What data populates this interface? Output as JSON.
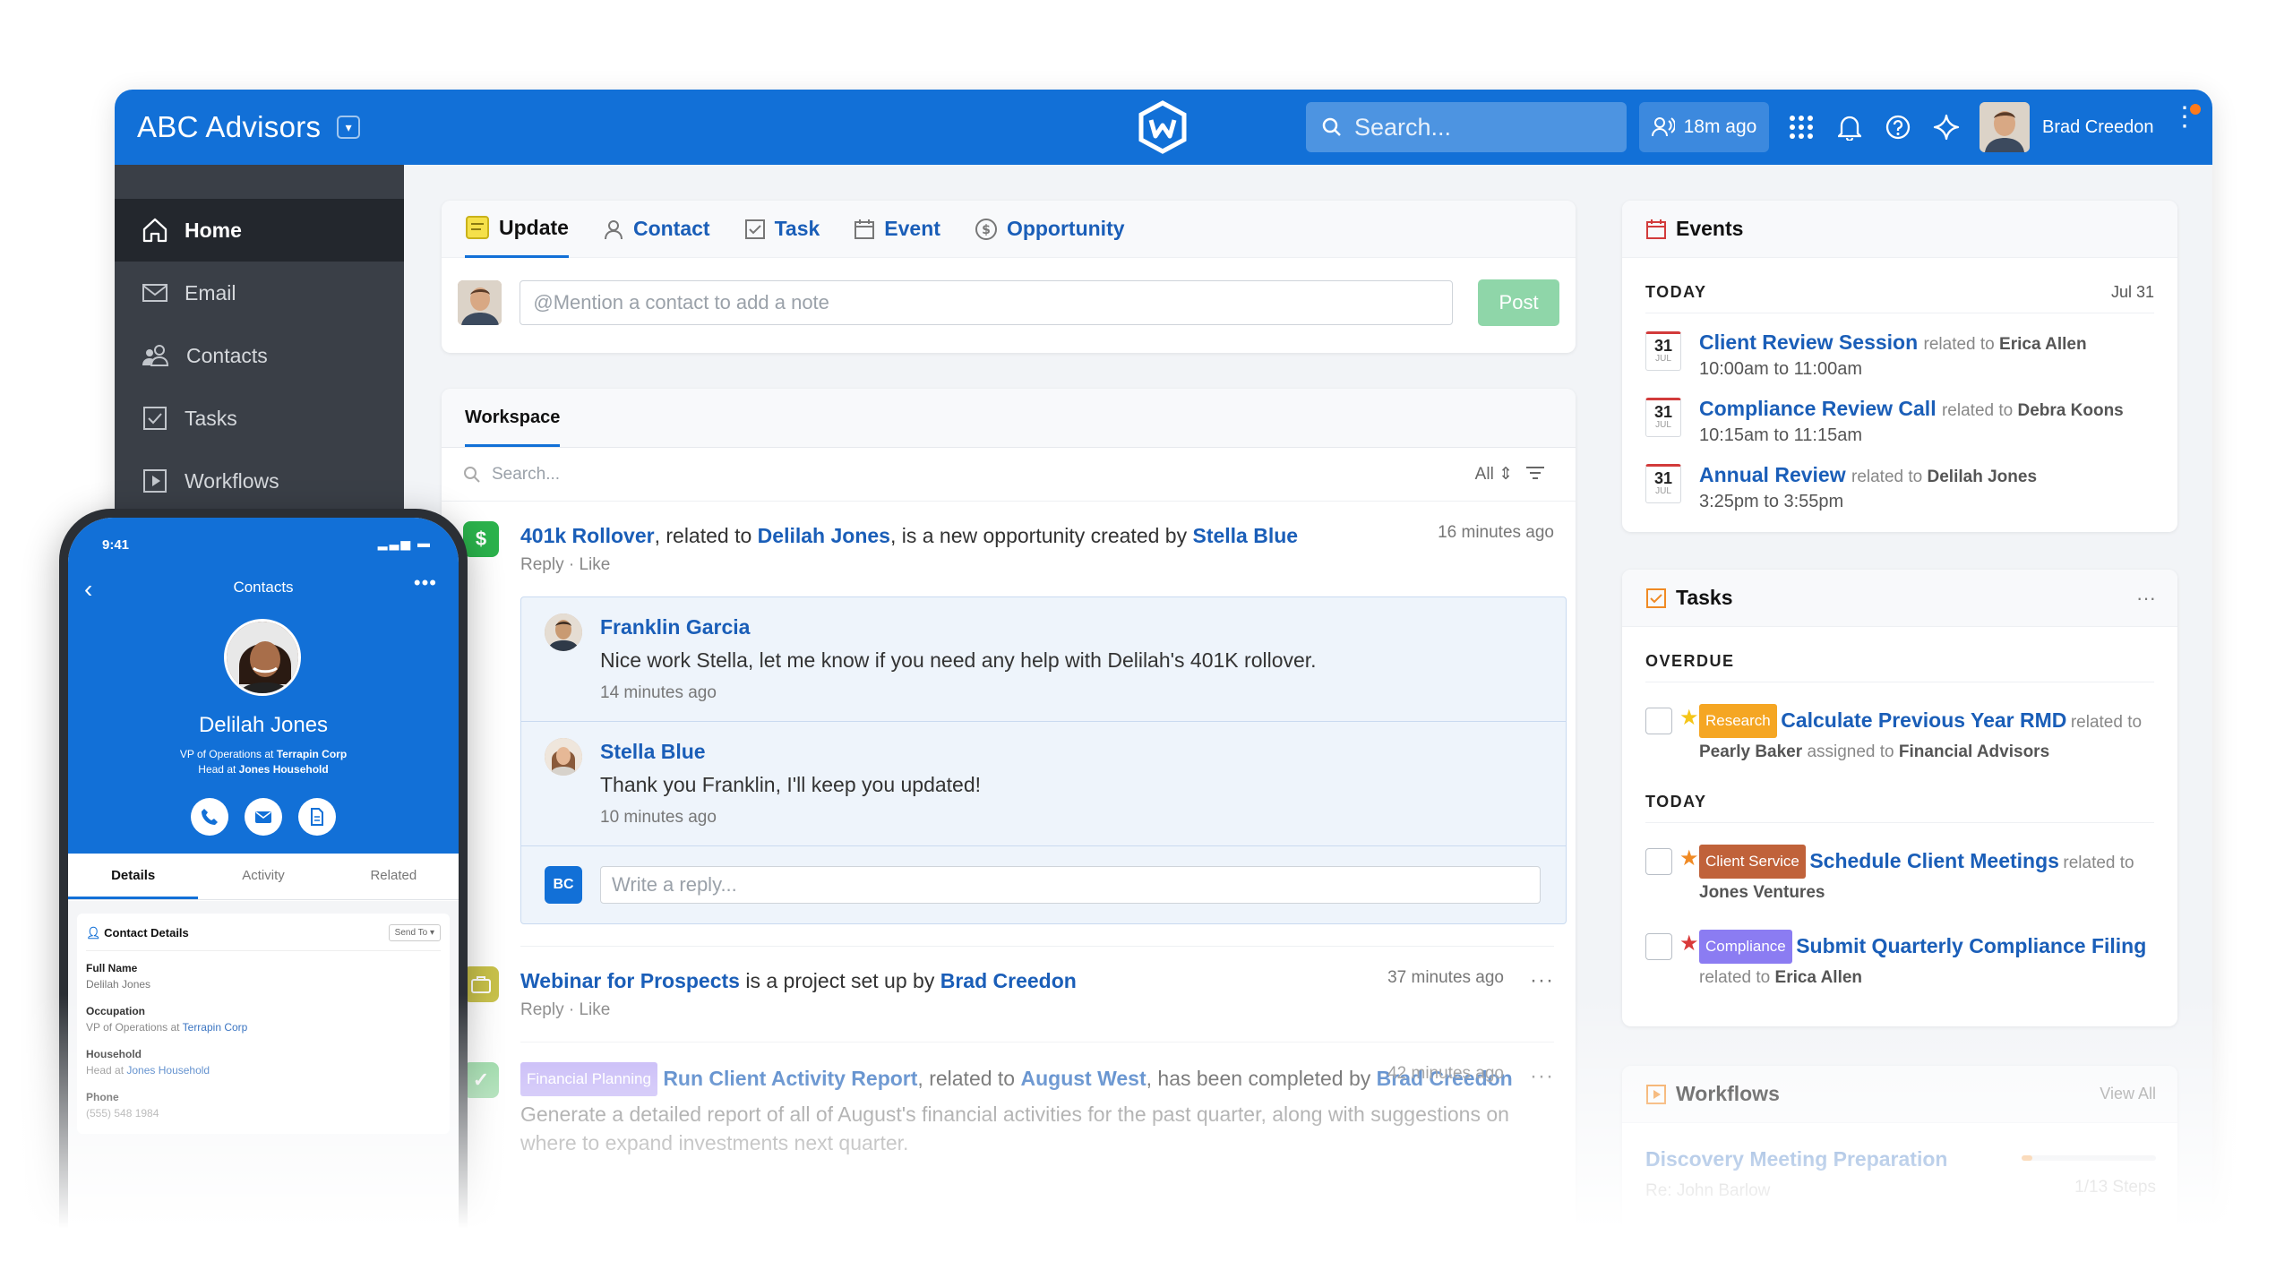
{
  "header": {
    "org_name": "ABC Advisors",
    "search_placeholder": "Search...",
    "sync_text": "18m ago",
    "user_name": "Brad Creedon"
  },
  "sidebar": {
    "items": [
      {
        "label": "Home",
        "icon": "home-icon"
      },
      {
        "label": "Email",
        "icon": "mail-icon"
      },
      {
        "label": "Contacts",
        "icon": "contacts-icon"
      },
      {
        "label": "Tasks",
        "icon": "checkbox-icon"
      },
      {
        "label": "Workflows",
        "icon": "play-icon"
      }
    ]
  },
  "composer": {
    "tabs": [
      "Update",
      "Contact",
      "Task",
      "Event",
      "Opportunity"
    ],
    "placeholder": "@Mention a contact to add a note",
    "post_label": "Post"
  },
  "workspace": {
    "title": "Workspace",
    "search_placeholder": "Search...",
    "filter_label": "All",
    "items": [
      {
        "link1": "401k Rollover",
        "text1": ", related to ",
        "link2": "Delilah Jones",
        "text2": ", is a new opportunity created by ",
        "link3": "Stella Blue",
        "time": "16 minutes ago",
        "actions": "Reply · Like",
        "replies": [
          {
            "name": "Franklin Garcia",
            "text": "Nice work Stella, let me know if you need any help with Delilah's 401K rollover.",
            "time": "14 minutes ago"
          },
          {
            "name": "Stella Blue",
            "text": "Thank you Franklin, I'll keep you updated!",
            "time": "10 minutes ago"
          }
        ],
        "reply_initials": "BC",
        "reply_placeholder": "Write a reply..."
      },
      {
        "link1": "Webinar for Prospects",
        "text1": " is a project set up by ",
        "link2": "Brad Creedon",
        "time": "37 minutes ago",
        "actions": "Reply · Like"
      },
      {
        "badge": "Financial Planning",
        "link1": "Run Client Activity Report",
        "text1": ", related to ",
        "link2": "August West",
        "text2": ", has been completed by ",
        "link3": "Brad Creedon",
        "time": "42 minutes ago",
        "description": "Generate a detailed report of all of August's financial activities for the past quarter, along with suggestions on where to expand investments next quarter."
      }
    ]
  },
  "events": {
    "title": "Events",
    "section": "TODAY",
    "date": "Jul 31",
    "items": [
      {
        "day": "31",
        "month": "JUL",
        "title": "Client Review Session",
        "related_prefix": "related to",
        "related": "Erica Allen",
        "time": "10:00am to 11:00am"
      },
      {
        "day": "31",
        "month": "JUL",
        "title": "Compliance Review Call",
        "related_prefix": "related to",
        "related": "Debra Koons",
        "time": "10:15am to 11:15am"
      },
      {
        "day": "31",
        "month": "JUL",
        "title": "Annual Review",
        "related_prefix": "related to",
        "related": "Delilah Jones",
        "time": "3:25pm to 3:55pm"
      }
    ]
  },
  "tasks": {
    "title": "Tasks",
    "more": "···",
    "overdue_label": "OVERDUE",
    "today_label": "TODAY",
    "overdue": [
      {
        "badge": "Research",
        "badge_color": "#f5a623",
        "star_color": "#f5c518",
        "title": "Calculate Previous Year RMD",
        "related_prefix": "related to",
        "related": "Pearly Baker",
        "assigned_prefix": "assigned to",
        "assigned": "Financial Advisors"
      }
    ],
    "today": [
      {
        "badge": "Client Service",
        "badge_color": "#c0623a",
        "star_color": "#f08a24",
        "title": "Schedule Client Meetings",
        "related_prefix": "related to",
        "related": "Jones Ventures"
      },
      {
        "badge": "Compliance",
        "badge_color": "#8b7cf2",
        "star_color": "#d93a3a",
        "title": "Submit Quarterly Compliance Filing",
        "related_prefix": "related to",
        "related": "Erica Allen"
      }
    ]
  },
  "workflows": {
    "title": "Workflows",
    "view_all": "View All",
    "item_title": "Discovery Meeting Preparation",
    "item_sub": "Re: John Barlow",
    "steps": "1/13 Steps",
    "progress": 0.08
  },
  "phone": {
    "time": "9:41",
    "title": "Contacts",
    "name": "Delilah Jones",
    "role_prefix": "VP of Operations at",
    "role_company": "Terrapin Corp",
    "head_prefix": "Head at",
    "head_household": "Jones Household",
    "tabs": [
      "Details",
      "Activity",
      "Related"
    ],
    "card_title": "Contact Details",
    "send_to": "Send To",
    "fields": [
      {
        "label": "Full Name",
        "value": "Delilah Jones"
      },
      {
        "label": "Occupation",
        "prefix": "VP of Operations at",
        "link": "Terrapin Corp"
      },
      {
        "label": "Household",
        "prefix": "Head at",
        "link": "Jones Household"
      },
      {
        "label": "Phone",
        "value": "(555) 548 1984"
      }
    ]
  },
  "colors": {
    "primary": "#1270d7",
    "sidebar": "#3a3f47",
    "link": "#1a5eb8",
    "post_button": "#8fd6a9",
    "opportunity_icon": "#2bb24c",
    "project_icon": "#c9c24a",
    "task_done_icon": "#7fd08f"
  }
}
